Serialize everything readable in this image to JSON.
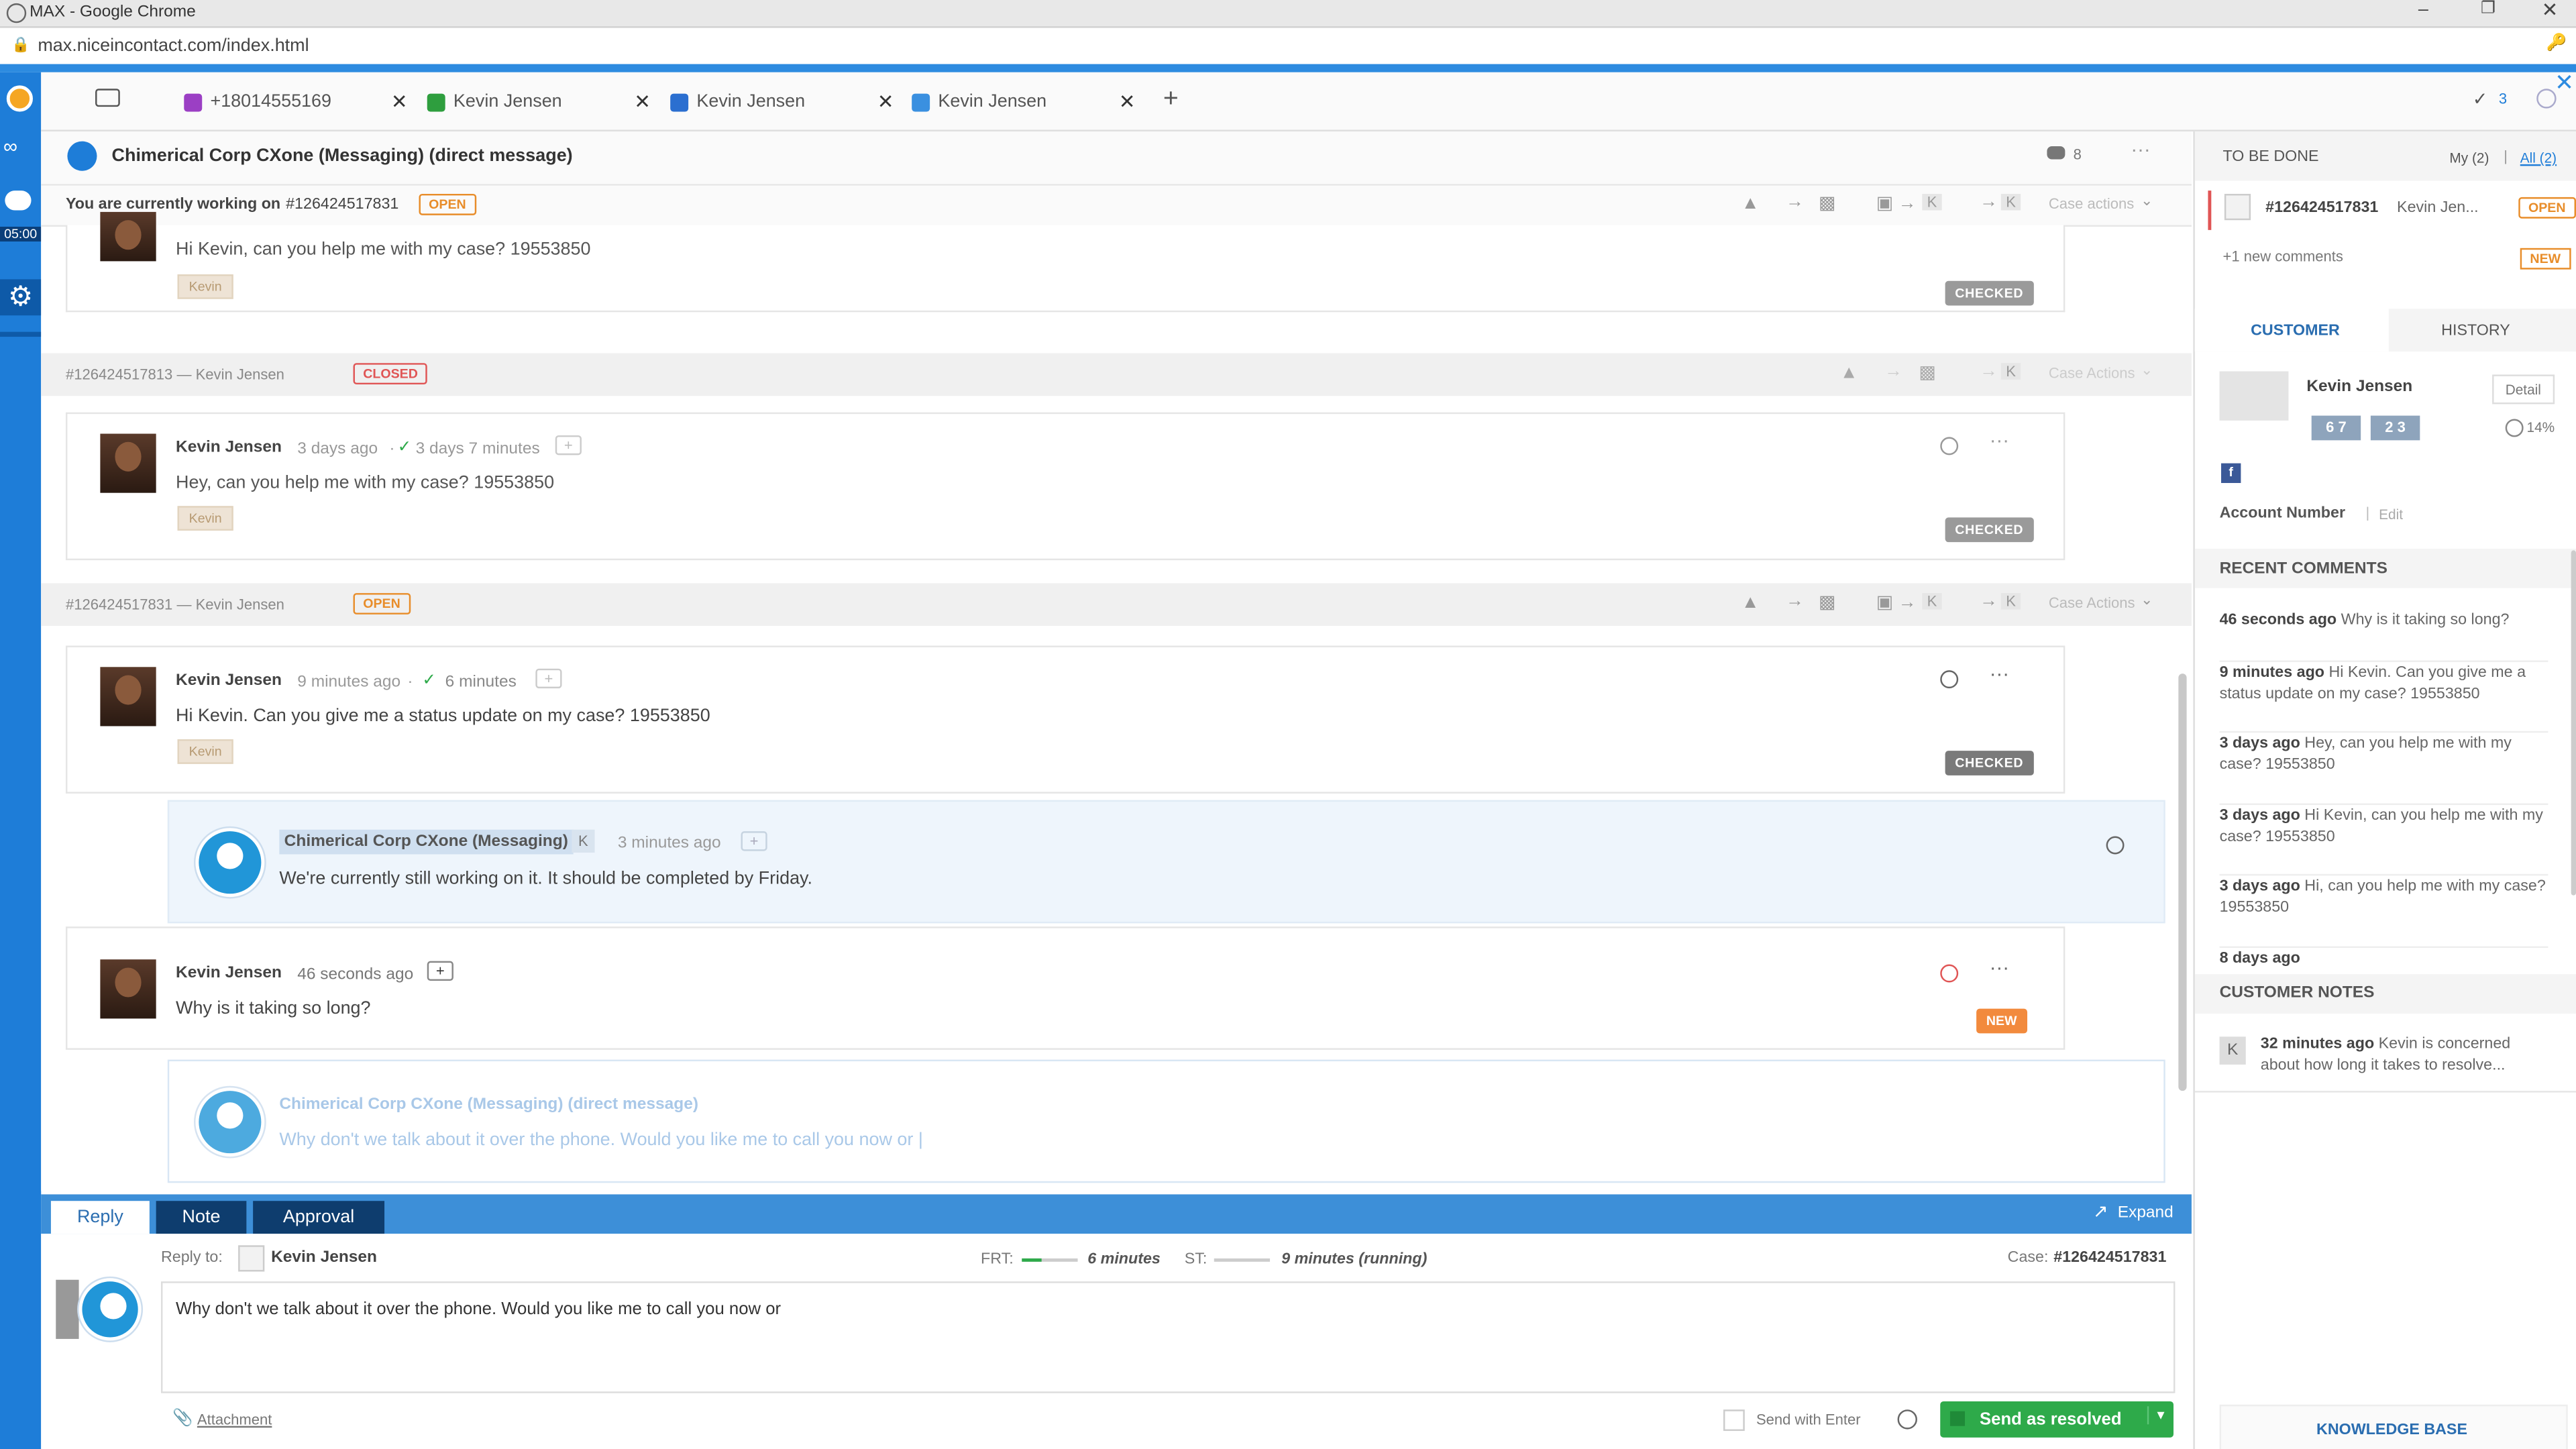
{
  "window": {
    "title": "MAX - Google Chrome",
    "url": "max.niceincontact.com/index.html"
  },
  "leftnav": {
    "timer": "05:00"
  },
  "tabs": [
    {
      "label": "+18014555169",
      "color": "#9b3fc4"
    },
    {
      "label": "Kevin Jensen",
      "color": "#2e9e3e"
    },
    {
      "label": "Kevin Jensen",
      "color": "#2b6fd0"
    },
    {
      "label": "Kevin Jensen",
      "color": "#3a90e0"
    }
  ],
  "tabs_add": "+",
  "tabs_right": {
    "check_count": "3"
  },
  "header": {
    "title": "Chimerical Corp CXone (Messaging) (direct message)",
    "comment_count": "8",
    "working_on_prefix": "You are currently working on",
    "working_on_case": "#126424517831",
    "working_on_status": "OPEN",
    "case_actions": "Case actions",
    "k": "K"
  },
  "thread": {
    "top_message": {
      "text": "Hi Kevin, can you help me with my case? 19553850",
      "tag": "Kevin",
      "status": "CHECKED"
    },
    "case_closed": {
      "label": "#126424517813 — Kevin Jensen",
      "status": "CLOSED",
      "case_actions": "Case Actions"
    },
    "msg1": {
      "author": "Kevin Jensen",
      "time": "3 days ago",
      "sep": "·",
      "check": "✓",
      "resp": "3 days 7 minutes",
      "text": "Hey, can you help me with my case? 19553850",
      "tag": "Kevin",
      "status": "CHECKED"
    },
    "case_open": {
      "label": "#126424517831 — Kevin Jensen",
      "status": "OPEN",
      "case_actions": "Case Actions"
    },
    "msg2": {
      "author": "Kevin Jensen",
      "time": "9 minutes ago",
      "sep": "·",
      "check": "✓",
      "resp": "6 minutes",
      "text": "Hi Kevin.  Can you give me a status update on my case? 19553850",
      "tag": "Kevin",
      "status": "CHECKED"
    },
    "agent1": {
      "author": "Chimerical Corp CXone (Messaging)",
      "k": "K",
      "time": "3 minutes ago",
      "text": "We're currently still working on it.  It should be completed by Friday."
    },
    "msg3": {
      "author": "Kevin Jensen",
      "time": "46 seconds ago",
      "text": "Why is it taking so long?",
      "status": "NEW"
    },
    "draft": {
      "author": "Chimerical Corp CXone (Messaging) (direct message)",
      "text": "Why don't we talk about it over the phone. Would you like me to call you now or |"
    }
  },
  "reply": {
    "tabs": [
      "Reply",
      "Note",
      "Approval"
    ],
    "expand": "Expand",
    "reply_to_label": "Reply to:",
    "reply_to_name": "Kevin Jensen",
    "frt_label": "FRT:",
    "frt_value": "6 minutes",
    "st_label": "ST:",
    "st_value": "9 minutes (running)",
    "case_label": "Case:",
    "case_value": "#126424517831",
    "body": "Why don't we talk about it over the phone.  Would you like me to call you now or",
    "attachment": "Attachment",
    "send_with_enter": "Send with Enter",
    "send_button": "Send as resolved"
  },
  "right": {
    "todo_title": "TO BE DONE",
    "my": "My (2)",
    "all": "All (2)",
    "todo_case": "#126424517831",
    "todo_name": "Kevin Jen...",
    "todo_status": "OPEN",
    "new_comments": "+1 new comments",
    "new_badge": "NEW",
    "tab_customer": "CUSTOMER",
    "tab_history": "HISTORY",
    "customer_name": "Kevin Jensen",
    "detail": "Detail",
    "pill1": "6 7",
    "pill2": "2 3",
    "sentiment": "14%",
    "account_number": "Account Number",
    "edit": "Edit",
    "recent_comments_title": "RECENT COMMENTS",
    "recent_comments": [
      {
        "when": "46 seconds ago",
        "text": "Why is it taking so long?"
      },
      {
        "when": "9 minutes ago",
        "text": "Hi Kevin. Can you give me a status update on my case? 19553850"
      },
      {
        "when": "3 days ago",
        "text": "Hey, can you help me with my case? 19553850"
      },
      {
        "when": "3 days ago",
        "text": "Hi Kevin, can you help me with my case? 19553850"
      },
      {
        "when": "3 days ago",
        "text": "Hi, can you help me with my case? 19553850"
      },
      {
        "when": "8 days ago",
        "text": ""
      }
    ],
    "customer_notes_title": "CUSTOMER NOTES",
    "note": {
      "k": "K",
      "when": "32 minutes ago",
      "text": "Kevin is concerned about how long it takes to resolve..."
    },
    "knowledge_base": "KNOWLEDGE BASE"
  }
}
